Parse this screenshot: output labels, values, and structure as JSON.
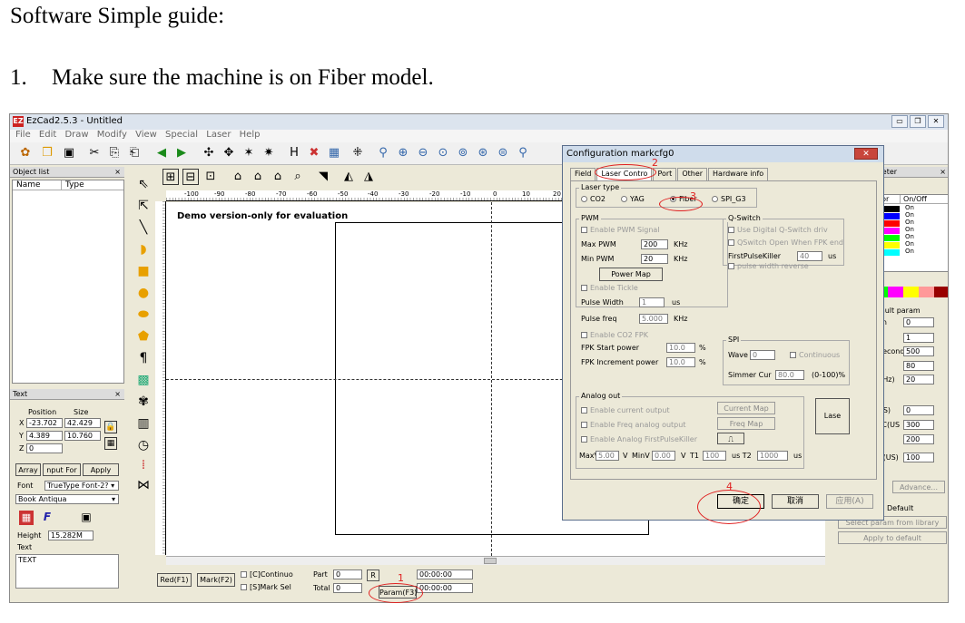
{
  "heading": "Software Simple guide:",
  "step_num": "1.",
  "step_text": "Make sure the machine is on Fiber model.",
  "app": {
    "logo": "EZ",
    "title": "EzCad2.5.3 - Untitled",
    "menu": [
      "File",
      "Edit",
      "Draw",
      "Modify",
      "View",
      "Special",
      "Laser",
      "Help"
    ]
  },
  "object_list": {
    "title": "Object list",
    "close": "×",
    "col_name": "Name",
    "col_type": "Type"
  },
  "ruler_ticks": [
    "-100",
    "-90",
    "-80",
    "-70",
    "-60",
    "-50",
    "-40",
    "-30",
    "-20",
    "-10",
    "0",
    "10",
    "20"
  ],
  "canvas": {
    "demo_text": "Demo version-only for evaluation"
  },
  "text_panel": {
    "title": "Text",
    "close": "×",
    "position_label": "Position",
    "size_label": "Size",
    "x_label": "X",
    "x_value": "-23.702",
    "x_size": "42.429",
    "y_label": "Y",
    "y_value": "4.389",
    "y_size": "10.760",
    "z_label": "Z",
    "z_value": "0",
    "array_btn": "Array",
    "input_btn": "nput For",
    "apply_btn": "Apply",
    "font_label": "Font",
    "font_type": "TrueType Font-2?",
    "font_name": "Book Antiqua",
    "height_label": "Height",
    "height_value": "15.282M",
    "text_label": "Text",
    "text_value": "TEXT"
  },
  "bottom_bar": {
    "red_btn": "Red(F1)",
    "mark_btn": "Mark(F2)",
    "continuo_label": "[C]Continuo",
    "marksel_label": "[S]Mark Sel",
    "part_label": "Part",
    "part_value": "0",
    "total_label": "Total",
    "total_value": "0",
    "r_btn": "R",
    "param_btn": "Param(F3)",
    "time1": "00:00:00",
    "time2": "00:00:00"
  },
  "right_panel": {
    "title": "meter",
    "close": "×",
    "col_color": "olor",
    "col_onoff": "On/Off",
    "rows_on": [
      "On",
      "On",
      "On",
      "On",
      "On",
      "On",
      "On"
    ],
    "default_param": "fault param",
    "rows": [
      {
        "label": "en",
        "value": "0"
      },
      {
        "label": "t",
        "value": "1"
      },
      {
        "label": "Second",
        "value": "500"
      },
      {
        "label": "",
        "value": "80"
      },
      {
        "label": "KHz)",
        "value": "20"
      },
      {
        "label": "US)",
        "value": "0"
      },
      {
        "label": "TC(US",
        "value": "300"
      },
      {
        "label": "",
        "value": "200"
      },
      {
        "label": "C(US)",
        "value": "100"
      }
    ],
    "advance_btn": "Advance...",
    "default_label": "Default",
    "select_lib_btn": "Select param from library",
    "apply_default_btn": "Apply to default"
  },
  "dialog": {
    "title": "Configuration markcfg0",
    "close": "✕",
    "tabs": [
      "Field",
      "Laser Contro",
      "Port",
      "Other",
      "Hardware info"
    ],
    "laser_type_label": "Laser type",
    "laser_types": [
      "CO2",
      "YAG",
      "Fiber",
      "SPI_G3"
    ],
    "pwm_label": "PWM",
    "enable_pwm": "Enable PWM Signal",
    "max_pwm_label": "Max PWM",
    "max_pwm_value": "200",
    "min_pwm_label": "Min PWM",
    "min_pwm_value": "20",
    "khz": "KHz",
    "power_map_btn": "Power Map",
    "enable_tickle": "Enable Tickle",
    "pulse_width_label": "Pulse Width",
    "pulse_width_value": "1",
    "us": "us",
    "pulse_freq_label": "Pulse freq",
    "pulse_freq_value": "5.000",
    "enable_co2_fpk": "Enable CO2 FPK",
    "fpk_start_label": "FPK Start power",
    "fpk_start_value": "10.0",
    "fpk_inc_label": "FPK Increment power",
    "fpk_inc_value": "10.0",
    "percent": "%",
    "qswitch_label": "Q-Switch",
    "use_digital_q": "Use Digital Q-Switch driv",
    "qswitch_open": "QSwitch Open When FPK end",
    "first_pulse_label": "FirstPulseKiller",
    "first_pulse_value": "40",
    "pulse_width_reverse": "pulse width reverse",
    "spi_label": "SPI",
    "wave_label": "Wave",
    "wave_value": "0",
    "continuous_label": "Continuous",
    "simmer_label": "Simmer Cur",
    "simmer_value": "80.0",
    "simmer_range": "(0-100)%",
    "analog_label": "Analog out",
    "enable_current": "Enable current output",
    "enable_freq": "Enable Freq analog output",
    "enable_analog_fpk": "Enable Analog FirstPulseKiller",
    "current_map_btn": "Current Map",
    "freq_map_btn": "Freq Map",
    "lase_btn": "Lase",
    "maxv_label": "MaxV",
    "maxv_value": "5.00",
    "v_label": "V",
    "minv_label": "MinV",
    "minv_value": "0.00",
    "t1_label": "T1",
    "t1_value": "100",
    "us_t2_label": "us T2",
    "t2_value": "1000",
    "ok_btn": "确定",
    "cancel_btn": "取消",
    "apply_btn": "应用(A)"
  },
  "callouts": [
    "1",
    "2",
    "3",
    "4"
  ]
}
